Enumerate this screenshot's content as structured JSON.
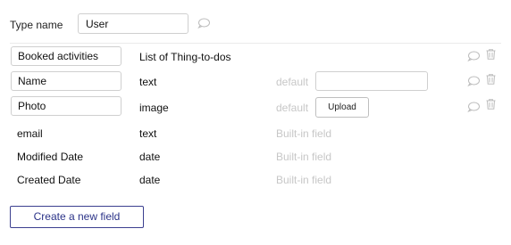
{
  "type_editor": {
    "type_name_label": "Type name",
    "type_name_value": "User"
  },
  "fields": [
    {
      "name": "Booked activities",
      "type": "List of Thing-to-dos",
      "editable": true,
      "default_kind": "none"
    },
    {
      "name": "Name",
      "type": "text",
      "editable": true,
      "default_kind": "input",
      "default_label": "default",
      "default_value": ""
    },
    {
      "name": "Photo",
      "type": "image",
      "editable": true,
      "default_kind": "upload",
      "default_label": "default",
      "upload_label": "Upload"
    },
    {
      "name": "email",
      "type": "text",
      "editable": false,
      "note": "Built-in field"
    },
    {
      "name": "Modified Date",
      "type": "date",
      "editable": false,
      "note": "Built-in field"
    },
    {
      "name": "Created Date",
      "type": "date",
      "editable": false,
      "note": "Built-in field"
    }
  ],
  "actions": {
    "create_field_label": "Create a new field"
  },
  "icons": {
    "comment": "comment-icon",
    "trash": "trash-icon"
  },
  "colors": {
    "accent": "#2b3388",
    "muted": "#c7c7c7",
    "border": "#cfcfcf"
  }
}
